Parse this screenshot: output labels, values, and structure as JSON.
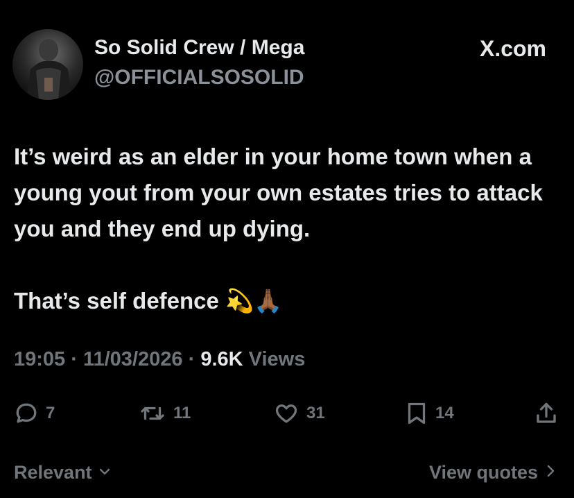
{
  "author": {
    "display_name": "So Solid Crew / Mega",
    "handle": "@OFFICIALSOSOLID"
  },
  "brand": "X.com",
  "tweet": {
    "paragraph1": "It’s weird as an elder in your home town when a young yout from your own estates tries to attack you and they end up dying.",
    "paragraph2": "That’s self defence",
    "emojis": "💫🙏🏾"
  },
  "meta": {
    "time": "19:05",
    "separator": "·",
    "date": "11/03/2026",
    "views_count": "9.6K",
    "views_label": "Views"
  },
  "actions": {
    "replies": "7",
    "reposts": "11",
    "likes": "31",
    "bookmarks": "14"
  },
  "footer": {
    "relevant_label": "Relevant",
    "view_quotes_label": "View quotes"
  },
  "icons": [
    "reply-icon",
    "repost-icon",
    "like-icon",
    "bookmark-icon",
    "share-icon",
    "chevron-down-icon",
    "chevron-right-icon"
  ]
}
